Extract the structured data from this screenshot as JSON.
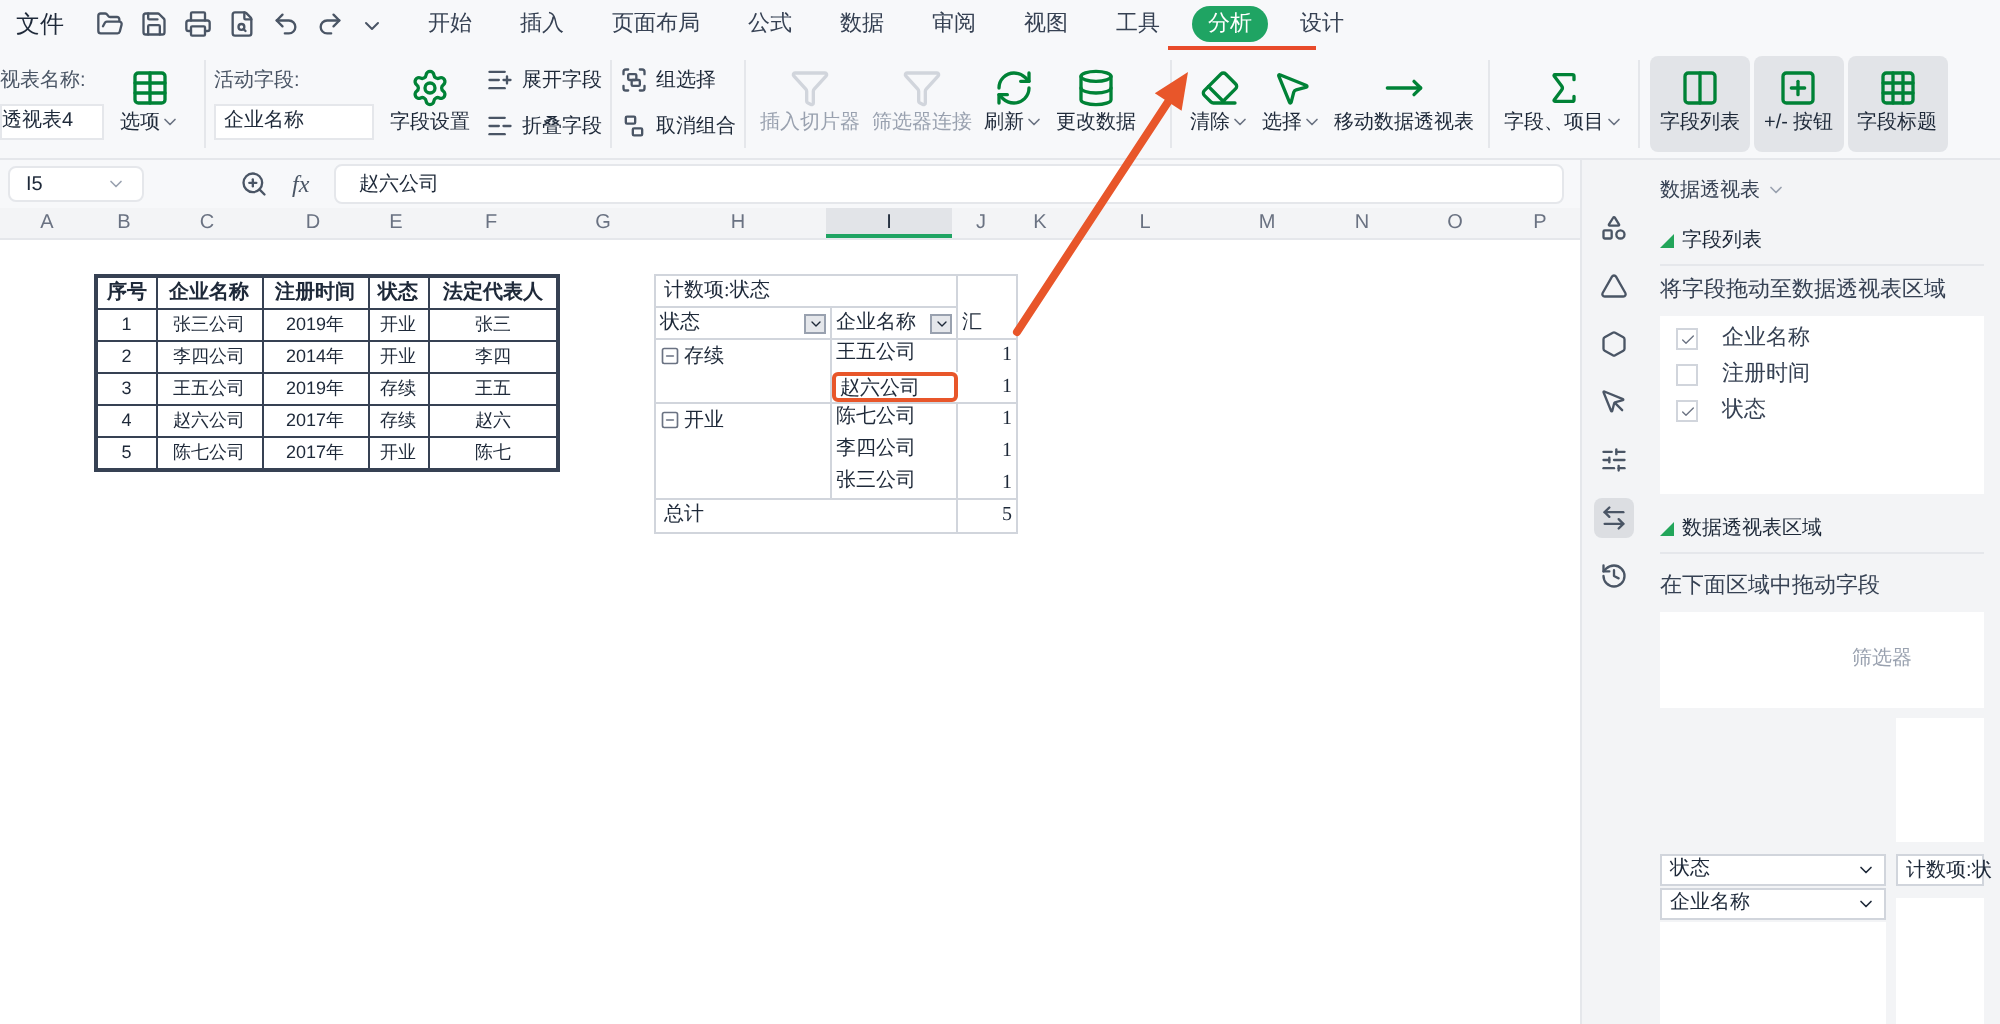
{
  "menu": {
    "file": "文件",
    "tabs": [
      {
        "label": "开始",
        "selected": false
      },
      {
        "label": "插入",
        "selected": false
      },
      {
        "label": "页面布局",
        "selected": false
      },
      {
        "label": "公式",
        "selected": false
      },
      {
        "label": "数据",
        "selected": false
      },
      {
        "label": "审阅",
        "selected": false
      },
      {
        "label": "视图",
        "selected": false
      },
      {
        "label": "工具",
        "selected": false
      },
      {
        "label": "分析",
        "selected": true
      },
      {
        "label": "设计",
        "selected": false
      }
    ]
  },
  "ribbon": {
    "pivot_name": {
      "label": "视表名称:",
      "value": "透视表4"
    },
    "options": {
      "label": "选项",
      "dropdown": true
    },
    "active_field": {
      "label": "活动字段:",
      "value": "企业名称"
    },
    "field_settings": "字段设置",
    "expand": "展开字段",
    "collapse": "折叠字段",
    "group_selection": "组选择",
    "ungroup": "取消组合",
    "tools": [
      {
        "kind": "slicer",
        "label": "插入切片器",
        "disabled": true,
        "dropdown": false
      },
      {
        "kind": "filter",
        "label": "筛选器连接",
        "disabled": true,
        "dropdown": false
      },
      {
        "kind": "refresh",
        "label": "刷新",
        "disabled": false,
        "dropdown": true
      },
      {
        "kind": "source",
        "label": "更改数据",
        "disabled": false,
        "dropdown": false
      },
      {
        "kind": "clear",
        "label": "清除",
        "disabled": false,
        "dropdown": true
      },
      {
        "kind": "select",
        "label": "选择",
        "disabled": false,
        "dropdown": true
      },
      {
        "kind": "move",
        "label": "移动数据透视表",
        "disabled": false,
        "dropdown": false
      },
      {
        "kind": "fx",
        "label": "字段、项目",
        "disabled": false,
        "dropdown": true
      }
    ],
    "toggles": [
      {
        "kind": "list",
        "label": "字段列表",
        "selected": true
      },
      {
        "kind": "plusminus",
        "label": "+/- 按钮",
        "selected": true
      },
      {
        "kind": "headers",
        "label": "字段标题",
        "selected": true
      }
    ]
  },
  "formula_bar": {
    "cell": "I5",
    "fx": "fx",
    "value": "赵六公司"
  },
  "columns": [
    {
      "label": "A",
      "selected": false
    },
    {
      "label": "B",
      "selected": false
    },
    {
      "label": "C",
      "selected": false
    },
    {
      "label": "D",
      "selected": false
    },
    {
      "label": "E",
      "selected": false
    },
    {
      "label": "F",
      "selected": false
    },
    {
      "label": "G",
      "selected": false
    },
    {
      "label": "H",
      "selected": false
    },
    {
      "label": "I",
      "selected": true
    },
    {
      "label": "J",
      "selected": false
    },
    {
      "label": "K",
      "selected": false
    },
    {
      "label": "L",
      "selected": false
    },
    {
      "label": "M",
      "selected": false
    },
    {
      "label": "N",
      "selected": false
    },
    {
      "label": "O",
      "selected": false
    },
    {
      "label": "P",
      "selected": false
    }
  ],
  "source_table": {
    "columns": [
      "序号",
      "企业名称",
      "注册时间",
      "状态",
      "法定代表人"
    ],
    "rows": [
      [
        "1",
        "张三公司",
        "2019年",
        "开业",
        "张三"
      ],
      [
        "2",
        "李四公司",
        "2014年",
        "开业",
        "李四"
      ],
      [
        "3",
        "王五公司",
        "2019年",
        "存续",
        "王五"
      ],
      [
        "4",
        "赵六公司",
        "2017年",
        "存续",
        "赵六"
      ],
      [
        "5",
        "陈七公司",
        "2017年",
        "开业",
        "陈七"
      ]
    ]
  },
  "pivot": {
    "title": "计数项:状态",
    "headers": [
      "状态",
      "企业名称",
      "汇"
    ],
    "groups": [
      {
        "label": "存续",
        "expanded": true,
        "items": [
          {
            "name": "王五公司",
            "count": "1",
            "selected": false
          },
          {
            "name": "赵六公司",
            "count": "1",
            "selected": true
          }
        ]
      },
      {
        "label": "开业",
        "expanded": true,
        "items": [
          {
            "name": "陈七公司",
            "count": "1",
            "selected": false
          },
          {
            "name": "李四公司",
            "count": "1",
            "selected": false
          },
          {
            "name": "张三公司",
            "count": "1",
            "selected": false
          }
        ]
      }
    ],
    "total": {
      "label": "总计",
      "value": "5"
    }
  },
  "side_tools": [
    {
      "kind": "shapes",
      "selected": false
    },
    {
      "kind": "style",
      "selected": false
    },
    {
      "kind": "hex",
      "selected": false
    },
    {
      "kind": "pointer",
      "selected": false
    },
    {
      "kind": "sliders",
      "selected": false
    },
    {
      "kind": "pivot",
      "selected": true
    },
    {
      "kind": "history",
      "selected": false
    }
  ],
  "panel": {
    "title": "数据透视表",
    "field_section": "字段列表",
    "field_hint": "将字段拖动至数据透视表区域",
    "fields": [
      {
        "label": "企业名称",
        "checked": true
      },
      {
        "label": "注册时间",
        "checked": false
      },
      {
        "label": "状态",
        "checked": true
      }
    ],
    "area_section": "数据透视表区域",
    "area_hint": "在下面区域中拖动字段",
    "filter_label": "筛选器",
    "row_fields": [
      "状态",
      "企业名称"
    ],
    "value_fields": [
      "计数项:状"
    ]
  }
}
